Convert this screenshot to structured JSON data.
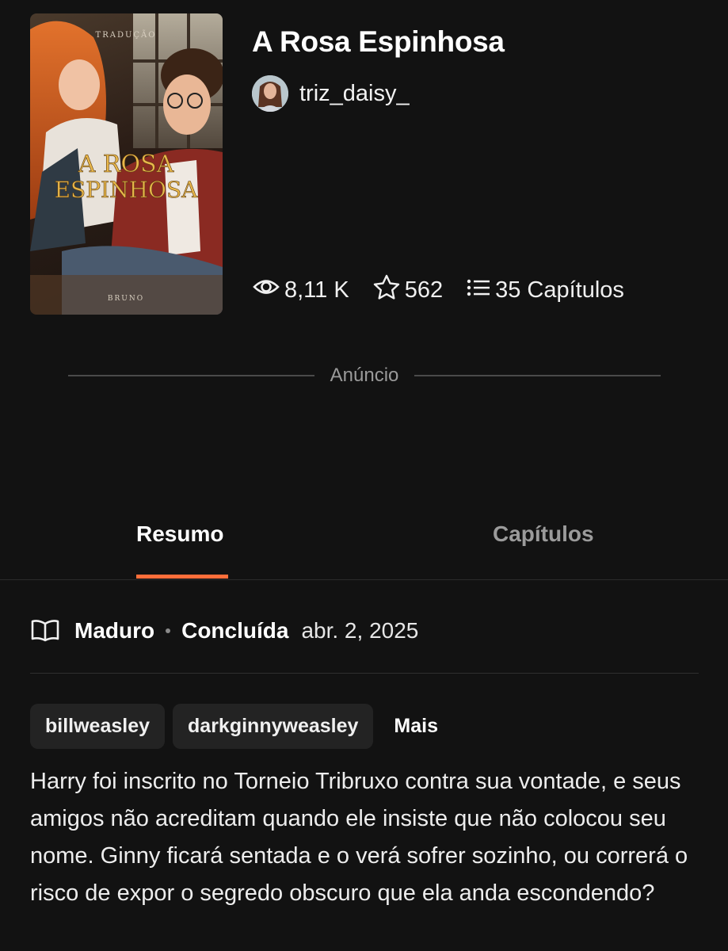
{
  "story": {
    "title": "A Rosa Espinhosa",
    "author": "triz_daisy_",
    "cover": {
      "title_text": "A ROSA ESPINHOSA",
      "top_text": "TRADUÇÃO",
      "bottom_text": "BRUNO"
    }
  },
  "stats": {
    "views": "8,11 K",
    "stars": "562",
    "chapters": "35 Capítulos"
  },
  "ad": {
    "label": "Anúncio"
  },
  "tabs": [
    {
      "label": "Resumo",
      "active": true
    },
    {
      "label": "Capítulos",
      "active": false
    }
  ],
  "meta": {
    "rating": "Maduro",
    "status": "Concluída",
    "date": "abr. 2, 2025"
  },
  "tags": [
    "billweasley",
    "darkginnyweasley"
  ],
  "tags_more": "Mais",
  "summary": "Harry foi inscrito no Torneio Tribruxo contra sua vontade, e seus amigos não acreditam quando ele insiste que não colocou seu nome. Ginny ficará sentada e o verá sofrer sozinho, ou correrá o risco de expor o segredo obscuro que ela anda escondendo?",
  "colors": {
    "background": "#121212",
    "accent": "#ff6e3a",
    "tag_bg": "#232323",
    "muted_text": "#9b9b9b"
  },
  "icons": {
    "views": "eye-icon",
    "stars": "star-icon",
    "chapters": "list-icon",
    "meta": "open-book-icon"
  }
}
